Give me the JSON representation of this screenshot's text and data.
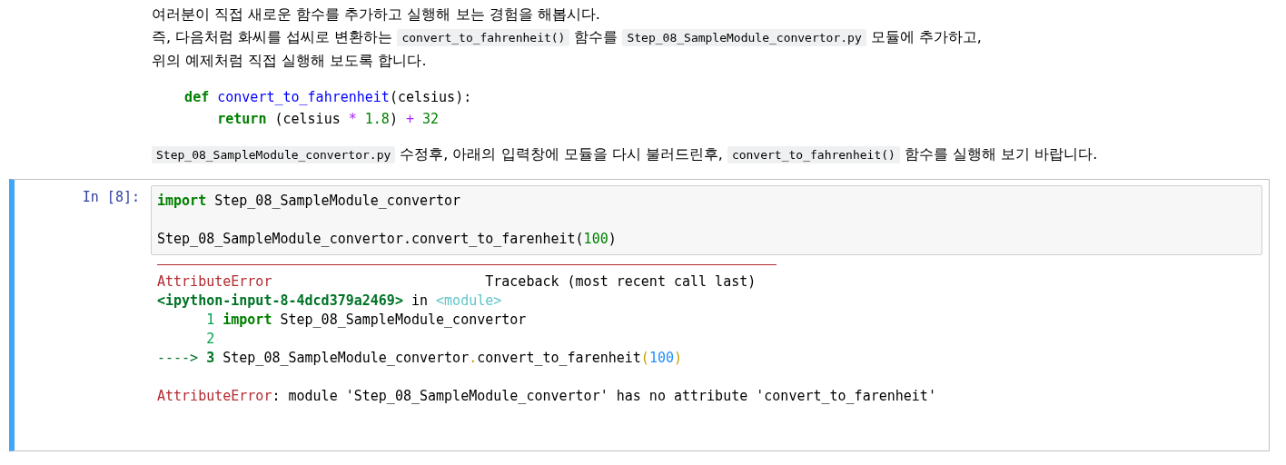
{
  "markdown": {
    "paragraphs": [
      [
        {
          "kind": "text",
          "text": "여러분이 직접 새로운 함수를 추가하고 실행해 보는 경험을 해봅시다."
        }
      ],
      [
        {
          "kind": "text",
          "text": "즉, 다음처럼 화씨를 섭씨로 변환하는"
        },
        {
          "kind": "code",
          "text": "convert_to_fahrenheit()"
        },
        {
          "kind": "text",
          "text": "함수를"
        },
        {
          "kind": "code",
          "text": "Step_08_SampleModule_convertor.py"
        },
        {
          "kind": "text",
          "text": "모듈에 추가하고,"
        }
      ],
      [
        {
          "kind": "text",
          "text": "위의 예제처럼 직접 실행해 보도록 합니다."
        }
      ]
    ],
    "code_block": [
      [
        {
          "kind": "keyword",
          "text": "    def"
        },
        {
          "kind": "function",
          "text": " convert_to_fahrenheit"
        },
        {
          "kind": "plain",
          "text": "(celsius):"
        }
      ],
      [
        {
          "kind": "keyword",
          "text": "        return"
        },
        {
          "kind": "plain",
          "text": " (celsius"
        },
        {
          "kind": "operator",
          "text": " *"
        },
        {
          "kind": "number",
          "text": " 1.8"
        },
        {
          "kind": "plain",
          "text": ")"
        },
        {
          "kind": "operator",
          "text": " +"
        },
        {
          "kind": "number",
          "text": " 32"
        }
      ]
    ],
    "closing": [
      {
        "kind": "code",
        "text": "Step_08_SampleModule_convertor.py"
      },
      {
        "kind": "text",
        "text": "수정후, 아래의 입력창에 모듈을 다시 불러드린후,"
      },
      {
        "kind": "code",
        "text": "convert_to_fahrenheit()"
      },
      {
        "kind": "text",
        "text": "함수를 실행해 보기 바랍니다."
      }
    ]
  },
  "cell": {
    "selected": true,
    "prompt": "In [8]:",
    "input_blocks": [
      [
        [
          {
            "kind": "keyword",
            "text": "import"
          },
          {
            "kind": "plain",
            "text": " Step_08_SampleModule_convertor"
          }
        ]
      ],
      [
        [
          {
            "kind": "plain",
            "text": "Step_08_SampleModule_convertor.convert_to_farenheit("
          },
          {
            "kind": "number",
            "text": "100"
          },
          {
            "kind": "plain",
            "text": ")"
          }
        ]
      ]
    ],
    "output_blocks": [
      [
        [
          {
            "kind": "error",
            "text": "AttributeError"
          },
          {
            "kind": "plain",
            "text": "                          Traceback (most recent call last)"
          }
        ],
        [
          {
            "kind": "location",
            "text": "<ipython-input-8-4dcd379a2469>"
          },
          {
            "kind": "plain",
            "text": " in "
          },
          {
            "kind": "module",
            "text": "<module>"
          }
        ],
        [
          {
            "kind": "lineno",
            "text": "      1"
          },
          {
            "kind": "keyword",
            "text": " import"
          },
          {
            "kind": "plain",
            "text": " Step_08_SampleModule_convertor"
          }
        ],
        [
          {
            "kind": "lineno",
            "text": "      2"
          }
        ],
        [
          {
            "kind": "arrow",
            "text": "---->"
          },
          {
            "kind": "current",
            "text": " 3"
          },
          {
            "kind": "plain",
            "text": " Step_08_SampleModule_convertor"
          },
          {
            "kind": "dot",
            "text": "."
          },
          {
            "kind": "plain",
            "text": "convert_to_farenheit"
          },
          {
            "kind": "paren",
            "text": "("
          },
          {
            "kind": "value",
            "text": "100"
          },
          {
            "kind": "paren",
            "text": ")"
          }
        ]
      ],
      [
        [
          {
            "kind": "error",
            "text": "AttributeError"
          },
          {
            "kind": "plain",
            "text": ": module 'Step_08_SampleModule_convertor' has no attribute 'convert_to_farenheit'"
          }
        ]
      ]
    ]
  }
}
